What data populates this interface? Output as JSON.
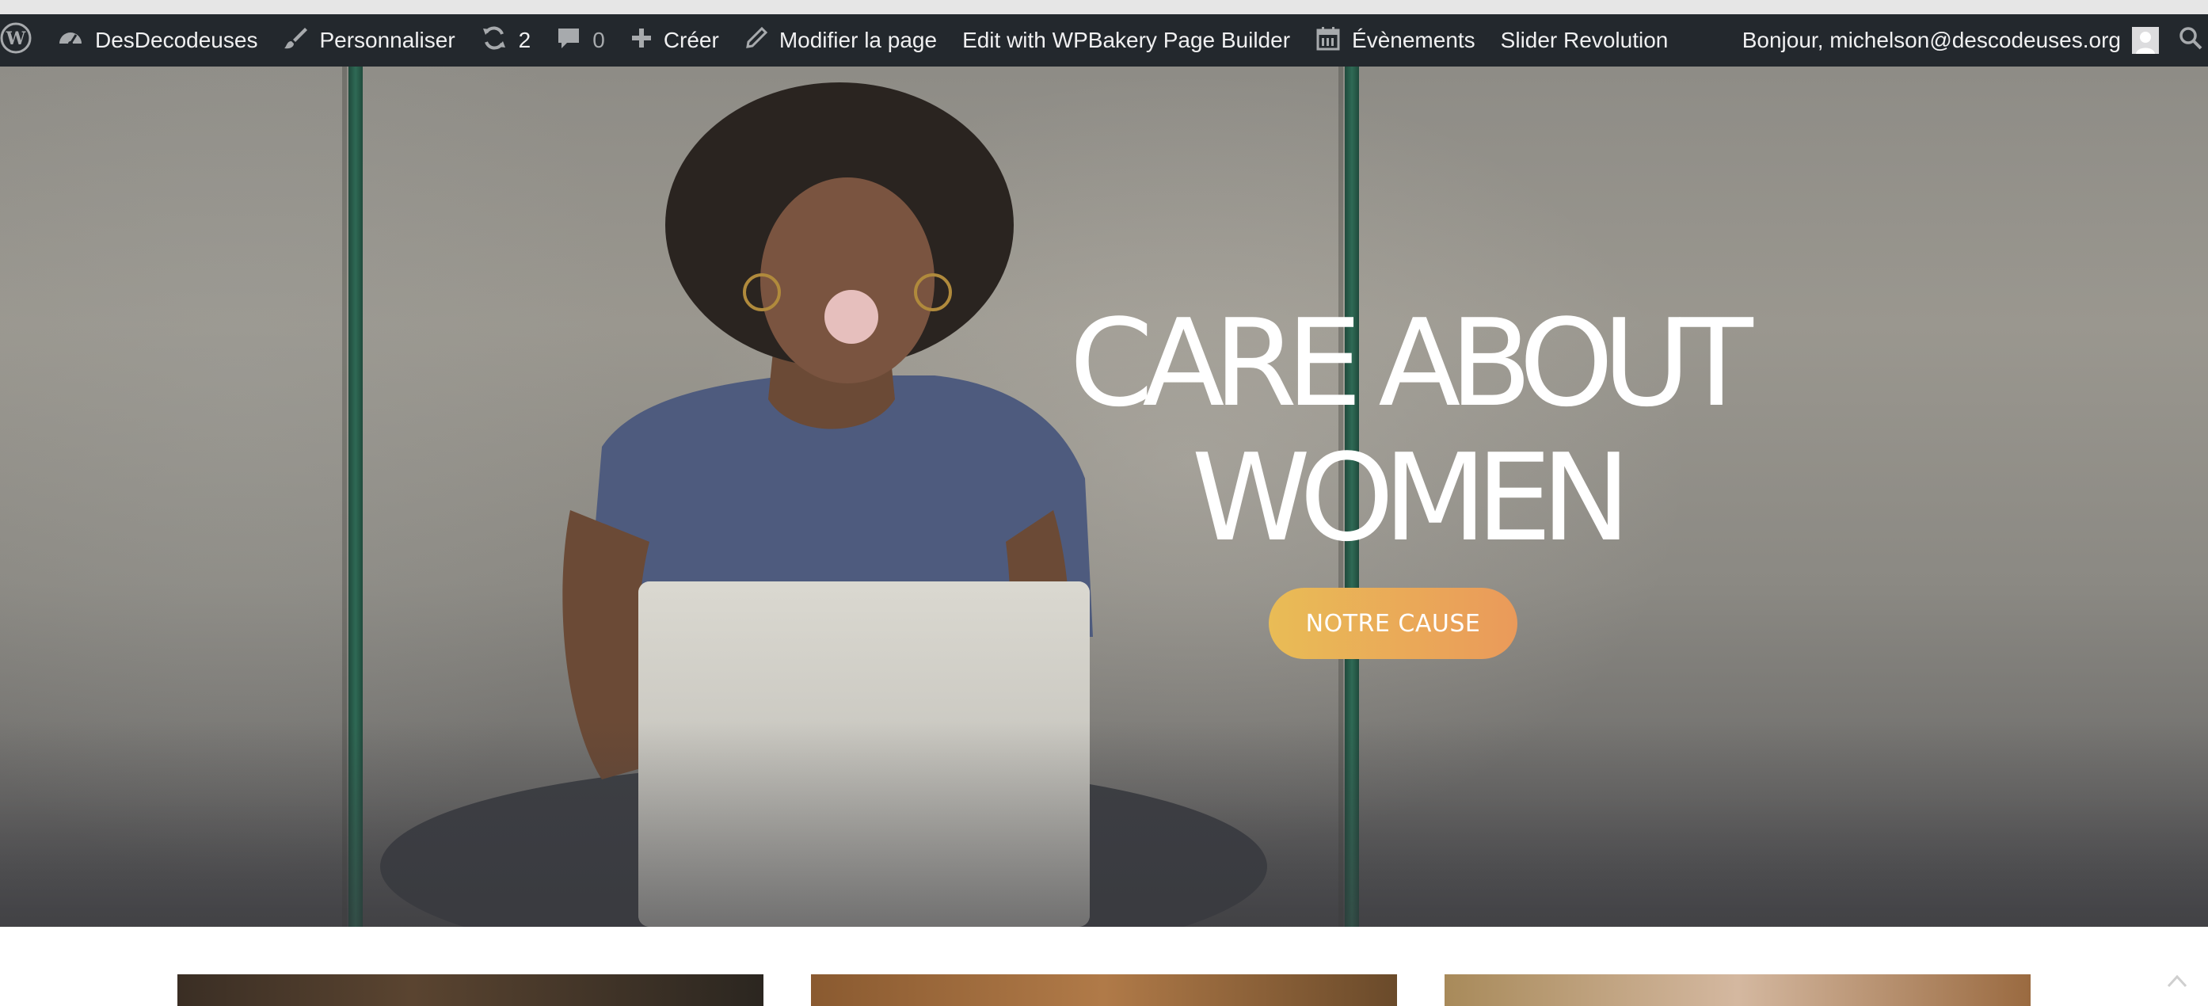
{
  "admin_bar": {
    "site_name": "DesDecodeuses",
    "customize": "Personnaliser",
    "updates_count": "2",
    "comments_count": "0",
    "new": "Créer",
    "edit_page": "Modifier la page",
    "wpbakery": "Edit with WPBakery Page Builder",
    "events": "Évènements",
    "slider": "Slider Revolution",
    "greeting": "Bonjour, michelson@descodeuses.org",
    "icons": [
      "wordpress-logo-icon",
      "dashboard-icon",
      "brush-icon",
      "updates-icon",
      "comments-icon",
      "plus-icon",
      "pencil-icon",
      "calendar-icon",
      "avatar-icon",
      "search-icon"
    ]
  },
  "hero": {
    "title_line1": "CARE ABOUT",
    "title_line2": "WOMEN",
    "cta_label": "NOTRE CAUSE"
  },
  "colors": {
    "admin_bar_bg": "#23282d",
    "admin_bar_text": "#f0f0f1",
    "cta_gradient_start": "#e9bc56",
    "cta_gradient_end": "#ea9a5a"
  }
}
